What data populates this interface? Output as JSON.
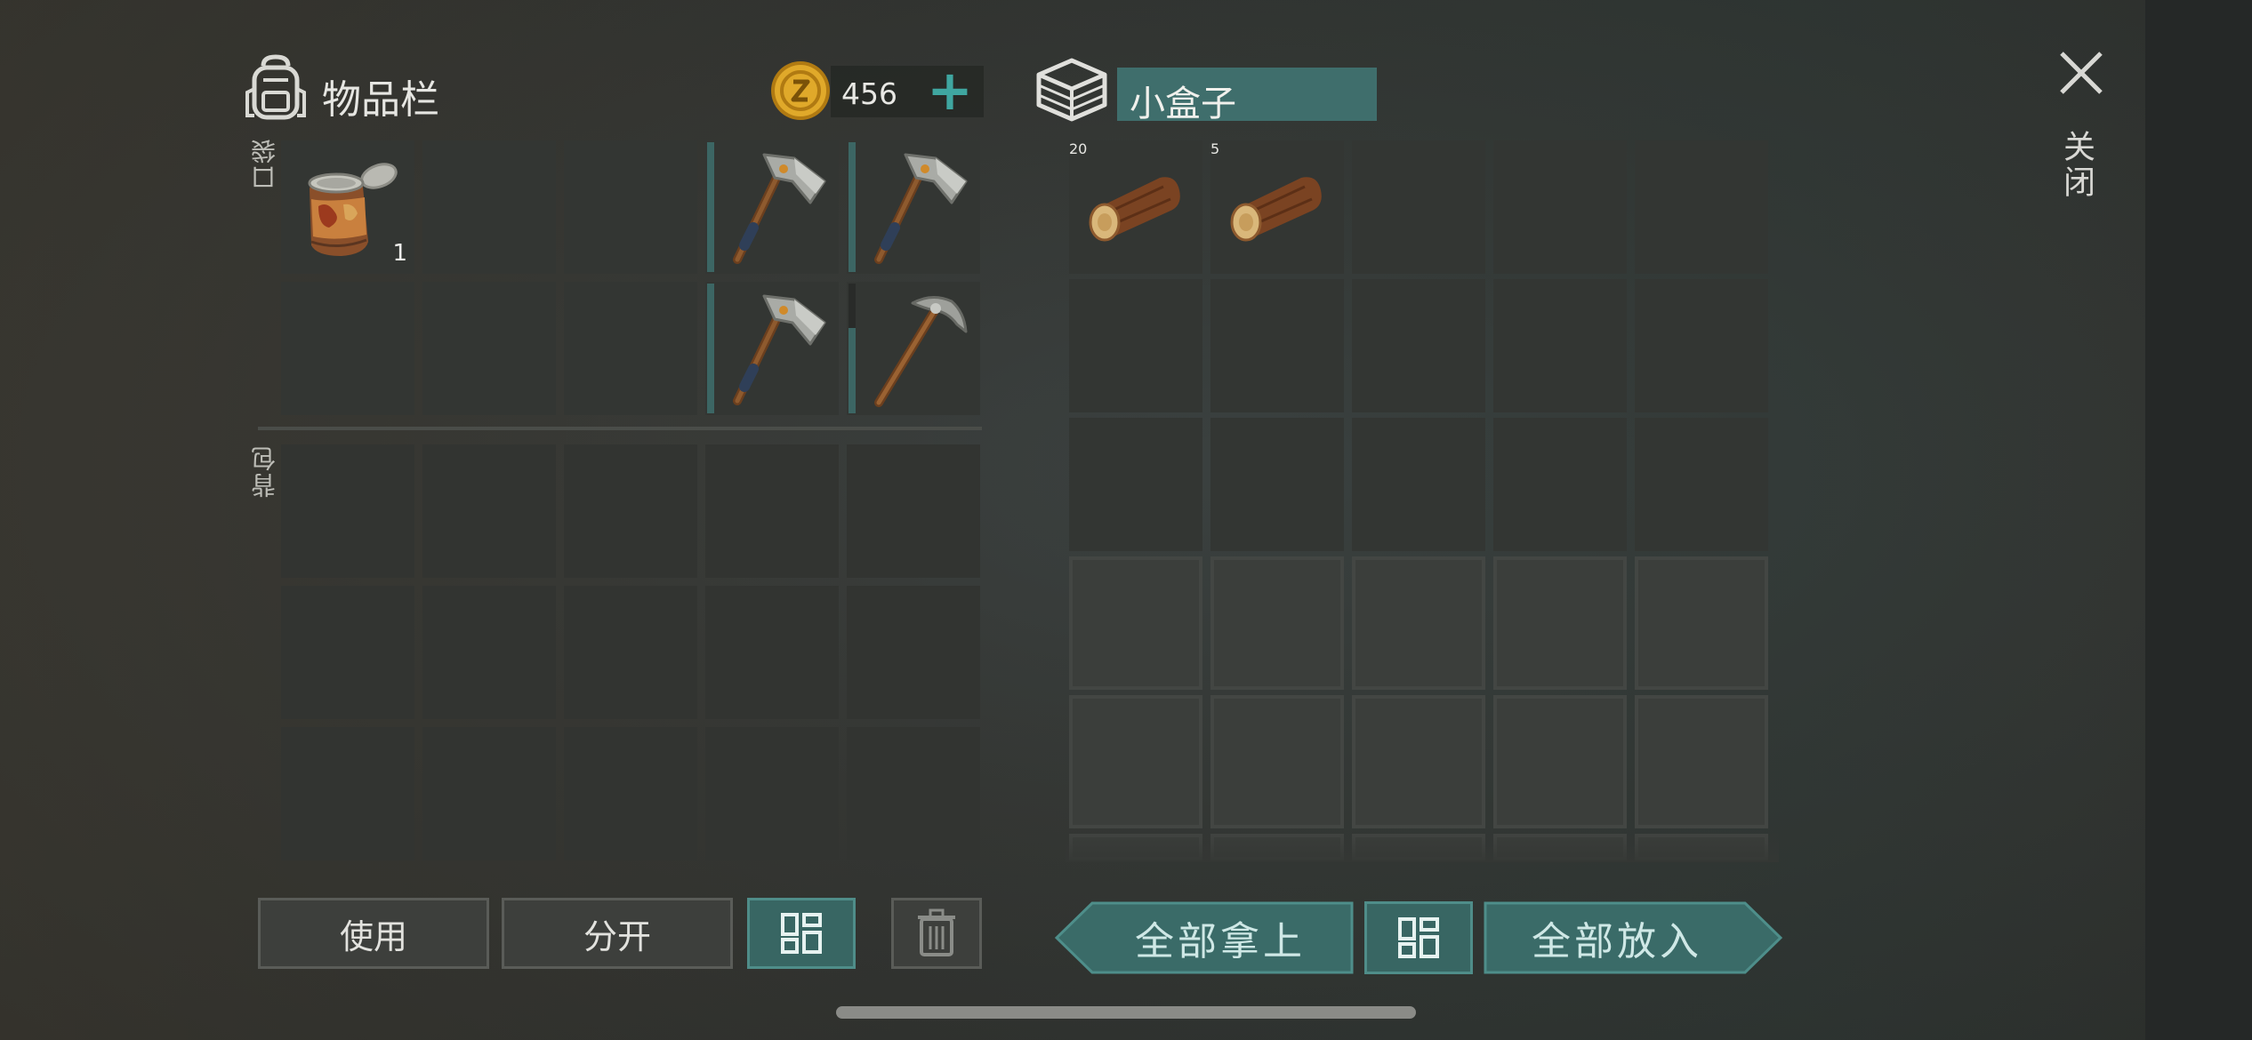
{
  "inventory": {
    "title": "物品栏",
    "coins": "456",
    "pocket_label": "口袋",
    "backpack_label": "背包",
    "pocket_slots": [
      {
        "item": "canned-food",
        "qty": "1"
      },
      {
        "item": null
      },
      {
        "item": null
      },
      {
        "item": "hatchet",
        "durability": 1.0
      },
      {
        "item": "hatchet",
        "durability": 1.0
      },
      {
        "item": null
      },
      {
        "item": null
      },
      {
        "item": null
      },
      {
        "item": "hatchet",
        "durability": 1.0
      },
      {
        "item": "pickaxe",
        "durability": 0.65
      }
    ]
  },
  "storage": {
    "title": "小盒子",
    "slots": [
      {
        "item": "log",
        "qty": "20"
      },
      {
        "item": "log",
        "qty": "5"
      }
    ]
  },
  "close_label": "关闭",
  "buttons": {
    "use": "使用",
    "split": "分开",
    "take_all": "全部拿上",
    "put_all": "全部放入"
  },
  "colors": {
    "accent_teal": "#3fa6a0",
    "title_bar": "#3f6e6c",
    "coin_gold": "#e0a92a"
  }
}
